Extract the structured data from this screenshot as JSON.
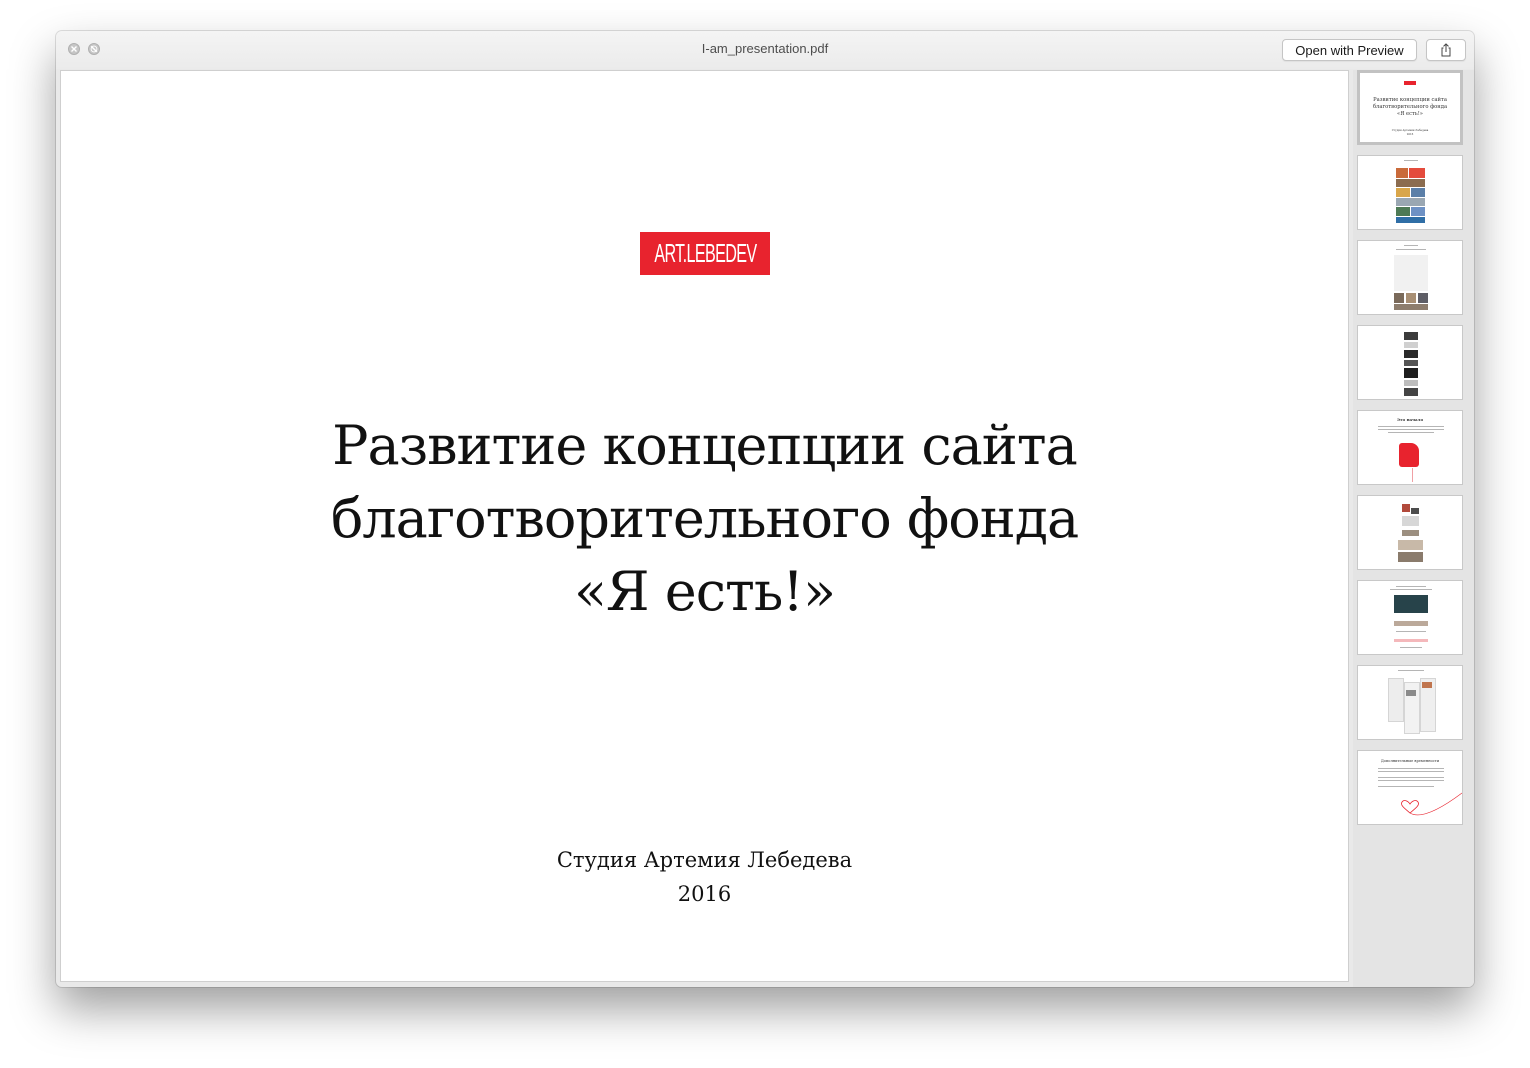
{
  "window": {
    "title": "I-am_presentation.pdf",
    "open_button_label": "Open with Preview"
  },
  "slide": {
    "logo_text": "ART.LEBEDEV",
    "title_lines": [
      "Развитие концепции сайта",
      "благотворительного фонда",
      "«Я есть!»"
    ],
    "studio": "Студия Артемия Лебедева",
    "year": "2016"
  },
  "thumbnails": [
    {
      "page": 1,
      "selected": true,
      "kind": "title",
      "lines": [
        "Развитие концепции сайта",
        "благотворительного фонда",
        "«Я есть!»"
      ],
      "footer": [
        "Студия Артемия Лебедева",
        "2016"
      ]
    },
    {
      "page": 2,
      "selected": false,
      "kind": "collage"
    },
    {
      "page": 3,
      "selected": false,
      "kind": "stories"
    },
    {
      "page": 4,
      "selected": false,
      "kind": "dark-list"
    },
    {
      "page": 5,
      "selected": false,
      "kind": "letter",
      "heading": "Это начало"
    },
    {
      "page": 6,
      "selected": false,
      "kind": "grid"
    },
    {
      "page": 7,
      "selected": false,
      "kind": "photo"
    },
    {
      "page": 8,
      "selected": false,
      "kind": "multi"
    },
    {
      "page": 9,
      "selected": false,
      "kind": "heart",
      "heading": "Дополнительные временности"
    }
  ],
  "colors": {
    "brand_red": "#e8232e"
  }
}
